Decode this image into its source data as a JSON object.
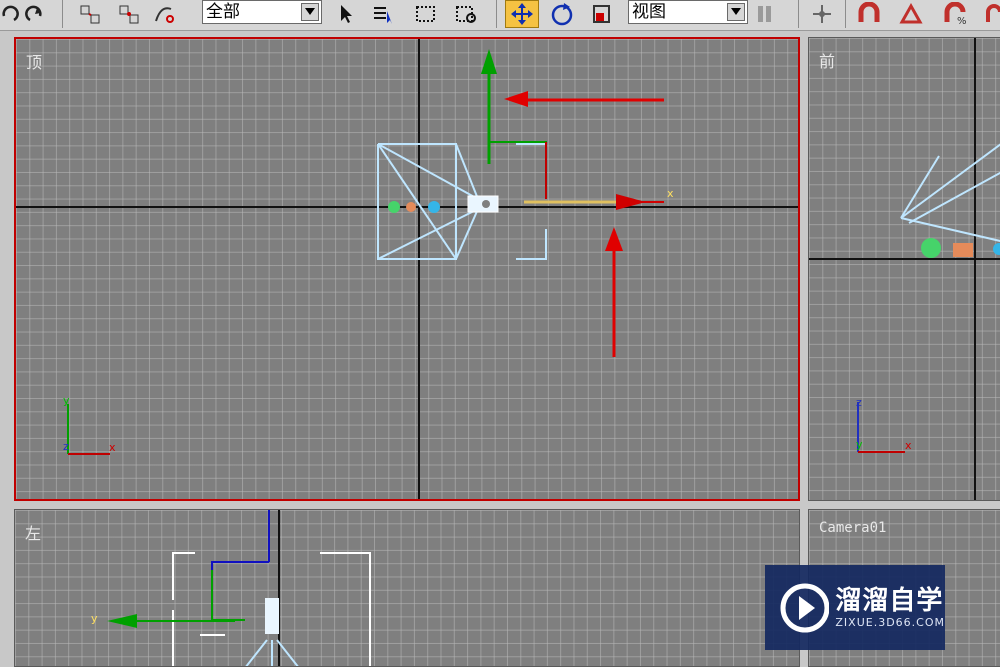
{
  "toolbar": {
    "selection_filter": {
      "selected": "全部"
    },
    "reference_coord": {
      "selected": "视图"
    },
    "icons": [
      "undo-icon",
      "redo-icon",
      "select-and-link-icon",
      "unlink-icon",
      "bind-space-warp-icon",
      "select-object-icon",
      "select-by-name-icon",
      "rectangle-selection-icon",
      "window-crossing-icon",
      "select-and-move-icon",
      "select-and-rotate-icon",
      "select-and-scale-icon",
      "use-pivot-point-icon",
      "select-and-manipulate-icon",
      "snap-toggle-icon",
      "angle-snap-icon",
      "percent-snap-icon"
    ],
    "active_tool": "select-and-move"
  },
  "viewports": {
    "top": {
      "label": "顶",
      "active": true,
      "border_color": "#c00000"
    },
    "front": {
      "label": "前"
    },
    "left": {
      "label": "左"
    },
    "camera": {
      "label": "Camera01"
    }
  },
  "axis_labels": {
    "x": "x",
    "y": "y",
    "z": "z"
  },
  "colors": {
    "viewport_bg": "#7f7f7f",
    "grid": "#b9b9b9",
    "active_border": "#c00000",
    "annotation_arrow": "#e00000",
    "gizmo_x": "#e00000",
    "gizmo_y": "#00a000",
    "gizmo_z": "#1010c0",
    "camera_wire": "#bfe6ff"
  },
  "watermark": {
    "brand": "溜溜自学",
    "url": "ZIXUE.3D66.COM"
  }
}
